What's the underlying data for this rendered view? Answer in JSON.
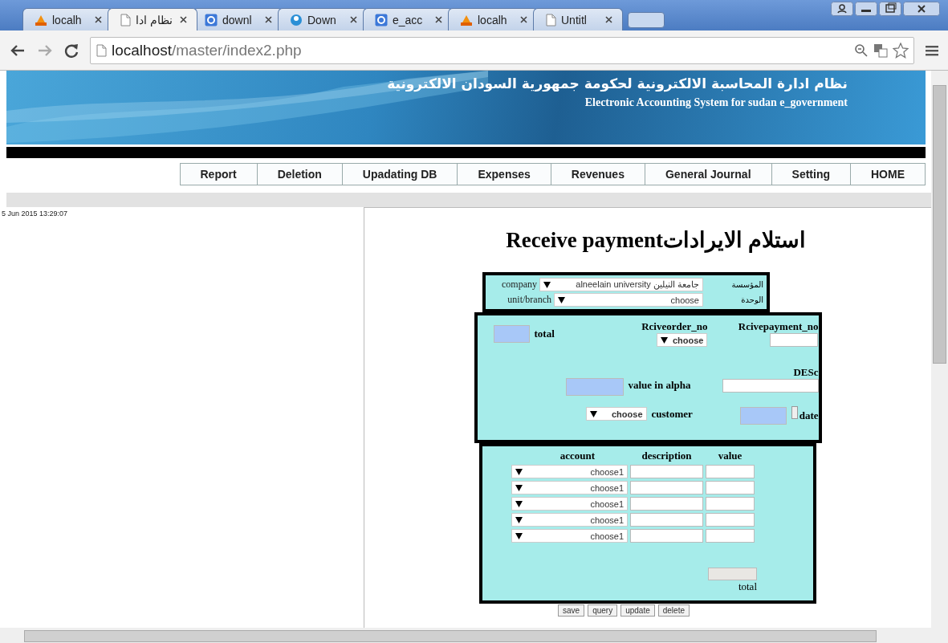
{
  "browser": {
    "tabs": [
      {
        "title": "localh",
        "kind": "pma",
        "selected": false
      },
      {
        "title": "نظام ادا",
        "kind": "page",
        "selected": true
      },
      {
        "title": "downl",
        "kind": "g",
        "selected": false
      },
      {
        "title": "Down",
        "kind": "globe",
        "selected": false
      },
      {
        "title": "e_acc",
        "kind": "g",
        "selected": false
      },
      {
        "title": "localh",
        "kind": "pma",
        "selected": false
      },
      {
        "title": "Untitl",
        "kind": "page",
        "selected": false
      }
    ],
    "address": {
      "host": "localhost",
      "path": "/master/index2.php"
    }
  },
  "header": {
    "title_ar": "نظام ادارة المحاسبة الالكترونية لحكومة جمهورية السودان الالكترونية",
    "title_en": "Electronic Accounting System for sudan e_government"
  },
  "nav": [
    "Report",
    "Deletion",
    "Upadating DB",
    "Expenses",
    "Revenues",
    "General Journal",
    "Setting",
    "HOME"
  ],
  "timestamp": "5 Jun 2015 13:29:07",
  "form": {
    "title_ar": "استلام الايرادات",
    "title_en": "Receive payment",
    "company": {
      "label": "company",
      "value": "alneelain university جامعة النيلين",
      "label_ar": "المؤسسة"
    },
    "unit": {
      "label": "unit/branch",
      "value": "choose",
      "label_ar": "الوحدة"
    },
    "total_label": "total",
    "order_label": "Rciveorder_no",
    "order_value": "choose",
    "payment_label": "Rcivepayment_no",
    "desc_label": "DESc",
    "alpha_label": "value in alpha",
    "customer_label": "customer",
    "customer_value": "choose",
    "date_label": "date",
    "lines": {
      "columns": [
        "account",
        "description",
        "value"
      ],
      "rows": [
        {
          "account": "choose1"
        },
        {
          "account": "choose1"
        },
        {
          "account": "choose1"
        },
        {
          "account": "choose1"
        },
        {
          "account": "choose1"
        }
      ],
      "total_label": "total"
    },
    "buttons": [
      "save",
      "query",
      "update",
      "delete"
    ]
  }
}
